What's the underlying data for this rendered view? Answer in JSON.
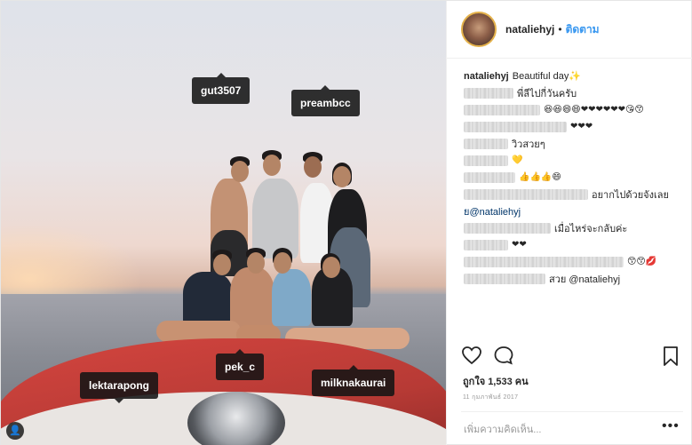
{
  "post": {
    "username": "nataliehyj",
    "follow_label": "ติดตาม",
    "separator": "•",
    "caption_user": "nataliehyj",
    "caption_text": "Beautiful day✨",
    "tags": [
      {
        "name": "gut3507"
      },
      {
        "name": "preambcc"
      },
      {
        "name": "lektarapong"
      },
      {
        "name": "pek_c"
      },
      {
        "name": "milknakaurai"
      }
    ],
    "comments": [
      {
        "text": "พี่ลีไปกี่วันครับ",
        "emoji": ""
      },
      {
        "text": "",
        "emoji": "😆😆😄😄❤❤❤❤❤❤😘😙"
      },
      {
        "text": "",
        "emoji": "❤❤❤"
      },
      {
        "text": "วิวสวยๆ",
        "emoji": ""
      },
      {
        "text": "",
        "emoji": "💛"
      },
      {
        "text": "",
        "emoji": "👍👍👍😄"
      },
      {
        "text": "อยากไปด้วยจังเลย",
        "emoji": ""
      },
      {
        "text": "ย@nataliehyj",
        "emoji": ""
      },
      {
        "text": "เมื่อไหร่จะกลับค่ะ",
        "emoji": ""
      },
      {
        "text": "",
        "emoji": "❤❤"
      },
      {
        "text": "",
        "emoji": "😙😙💋"
      },
      {
        "text": "สวย @nataliehyj",
        "emoji": ""
      }
    ],
    "likes_label": "ถูกใจ 1,533 คน",
    "date": "11 กุมภาพันธ์ 2017",
    "add_comment_placeholder": "เพิ่มความคิดเห็น...",
    "more_label": "•••"
  },
  "icons": {
    "like": "heart-icon",
    "comment": "comment-icon",
    "save": "bookmark-icon",
    "tagged_user": "user-icon"
  }
}
